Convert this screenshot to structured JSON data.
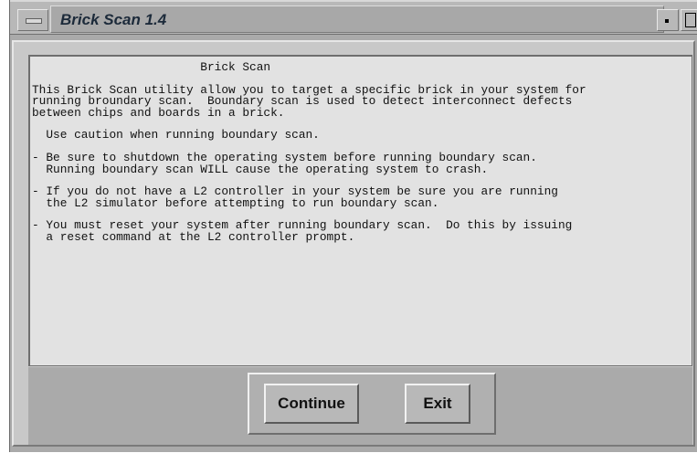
{
  "window": {
    "title": "Brick Scan 1.4"
  },
  "content": {
    "heading": "                        Brick Scan",
    "lines": [
      "This Brick Scan utility allow you to target a specific brick in your system for",
      "running broundary scan.  Boundary scan is used to detect interconnect defects",
      "between chips and boards in a brick.",
      "",
      "  Use caution when running boundary scan.",
      "",
      "- Be sure to shutdown the operating system before running boundary scan.",
      "  Running boundary scan WILL cause the operating system to crash.",
      "",
      "- If you do not have a L2 controller in your system be sure you are running",
      "  the L2 simulator before attempting to run boundary scan.",
      "",
      "- You must reset your system after running boundary scan.  Do this by issuing",
      "  a reset command at the L2 controller prompt."
    ]
  },
  "buttons": {
    "continue_label": "Continue",
    "exit_label": "Exit"
  },
  "colors": {
    "text_panel_bg": "#e2e2e2",
    "window_bg": "#aaaaaa",
    "title_text": "#1c2a3a"
  }
}
